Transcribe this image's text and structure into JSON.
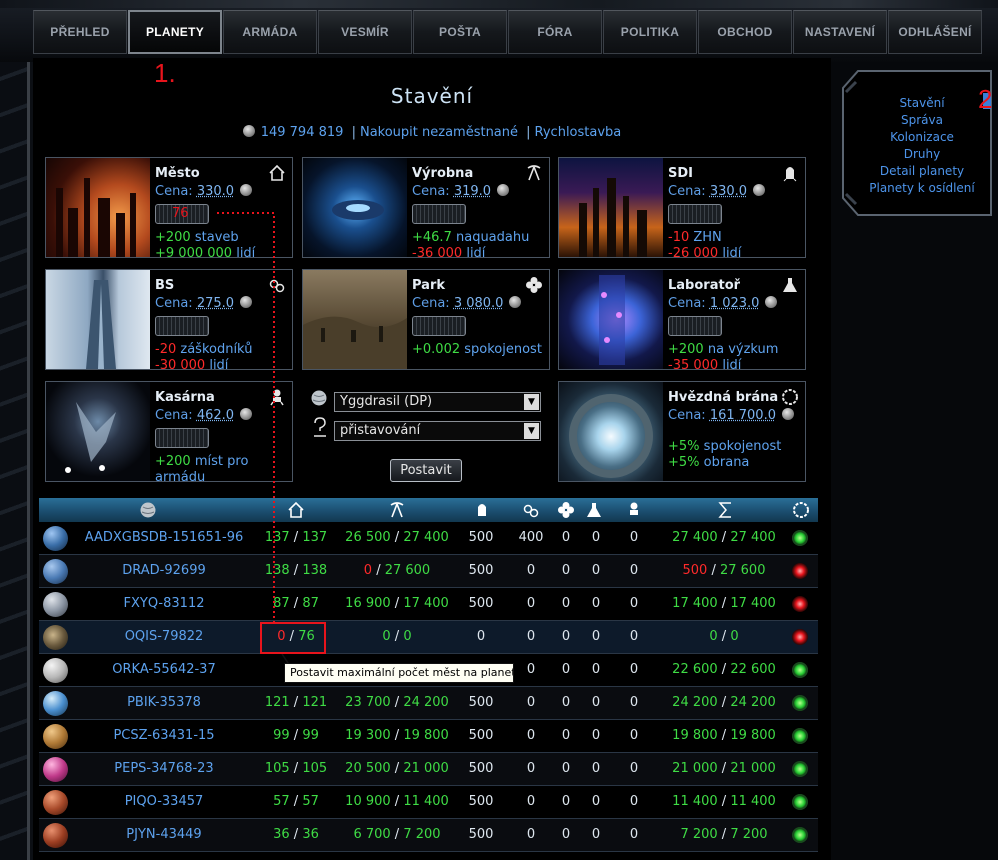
{
  "nav": {
    "items": [
      {
        "label": "PŘEHLED"
      },
      {
        "label": "PLANETY",
        "active": true
      },
      {
        "label": "ARMÁDA"
      },
      {
        "label": "VESMÍR"
      },
      {
        "label": "POŠTA"
      },
      {
        "label": "FÓRA"
      },
      {
        "label": "POLITIKA"
      },
      {
        "label": "OBCHOD"
      },
      {
        "label": "NASTAVENÍ"
      },
      {
        "label": "ODHLÁŠENÍ"
      }
    ]
  },
  "annotations": {
    "one": "1.",
    "two": "2"
  },
  "page_title": "Stavění",
  "info": {
    "money": "149 794 819",
    "buy_unemployed": "Nakoupit nezaměstnané",
    "separator": "|",
    "quick_build": "Rychlostavba"
  },
  "buildings": {
    "mesto": {
      "name": "Město",
      "cost_label": "Cena:",
      "cost": "330.0",
      "qty": "76",
      "eff1_val": "+200",
      "eff1_label": "staveb",
      "eff2_val": "+9 000 000",
      "eff2_label": "lidí"
    },
    "vyrobna": {
      "name": "Výrobna",
      "cost_label": "Cena:",
      "cost": "319.0",
      "qty": "",
      "eff1_val": "+46.7",
      "eff1_label": "naquadahu",
      "eff2_val": "-36 000",
      "eff2_label": "lidí"
    },
    "sdi": {
      "name": "SDI",
      "cost_label": "Cena:",
      "cost": "330.0",
      "qty": "",
      "eff1_val": "-10",
      "eff1_label": "ZHN",
      "eff2_val": "-26 000",
      "eff2_label": "lidí"
    },
    "bs": {
      "name": "BS",
      "cost_label": "Cena:",
      "cost": "275.0",
      "qty": "",
      "eff1_val": "-20",
      "eff1_label": "záškodníků",
      "eff2_val": "-30 000",
      "eff2_label": "lidí"
    },
    "park": {
      "name": "Park",
      "cost_label": "Cena:",
      "cost": "3 080.0",
      "qty": "",
      "eff1_val": "+0.002",
      "eff1_label": "spokojenost",
      "eff2_val": "",
      "eff2_label": ""
    },
    "lab": {
      "name": "Laboratoř",
      "cost_label": "Cena:",
      "cost": "1 023.0",
      "qty": "",
      "eff1_val": "+200",
      "eff1_label": "na výzkum",
      "eff2_val": "-35 000",
      "eff2_label": "lidí"
    },
    "kasarna": {
      "name": "Kasárna",
      "cost_label": "Cena:",
      "cost": "462.0",
      "qty": "",
      "eff1_val": "+200",
      "eff1_label": "míst pro",
      "eff2_val": "",
      "eff2_label": "armádu"
    },
    "brana": {
      "name": "Hvězdná brána",
      "cost_label": "Cena:",
      "cost": "161 700.0",
      "qty": "",
      "eff1_val": "+5%",
      "eff1_label": "spokojenost",
      "eff2_val": "+5%",
      "eff2_label": "obrana"
    }
  },
  "controls": {
    "planet_select": "Yggdrasil (DP)",
    "mode_select": "přistavování",
    "build_button": "Postavit"
  },
  "planets": [
    {
      "name": "AADXGBSDB-151651-96",
      "type": "blue",
      "m_cur": "137",
      "m_max": "137",
      "m_col": "g",
      "v_cur": "26 500",
      "v_max": "27 400",
      "v_col": "g",
      "sdi": "500",
      "bs": "400",
      "park": "0",
      "lab": "0",
      "kas": "0",
      "t_cur": "27 400",
      "t_max": "27 400",
      "t_col": "g",
      "gate": "on"
    },
    {
      "name": "DRAD-92699",
      "type": "blue2",
      "m_cur": "138",
      "m_max": "138",
      "m_col": "g",
      "v_cur": "0",
      "v_max": "27 600",
      "v_col": "r",
      "sdi": "500",
      "bs": "0",
      "park": "0",
      "lab": "0",
      "kas": "0",
      "t_cur": "500",
      "t_max": "27 600",
      "t_col": "r",
      "gate": "off"
    },
    {
      "name": "FXYQ-83112",
      "type": "grey",
      "m_cur": "87",
      "m_max": "87",
      "m_col": "g",
      "v_cur": "16 900",
      "v_max": "17 400",
      "v_col": "g",
      "sdi": "500",
      "bs": "0",
      "park": "0",
      "lab": "0",
      "kas": "0",
      "t_cur": "17 400",
      "t_max": "17 400",
      "t_col": "g",
      "gate": "off"
    },
    {
      "name": "OQIS-79822",
      "type": "rock",
      "m_cur": "0",
      "m_max": "76",
      "m_col": "r",
      "v_cur": "0",
      "v_max": "0",
      "v_col": "g",
      "sdi": "0",
      "bs": "0",
      "park": "0",
      "lab": "0",
      "kas": "0",
      "t_cur": "0",
      "t_max": "0",
      "t_col": "g",
      "gate": "off"
    },
    {
      "name": "ORKA-55642-37",
      "type": "moon",
      "m_cur": "11",
      "m_max": "",
      "m_col": "g",
      "v_cur": "",
      "v_max": "",
      "v_col": "g",
      "sdi": "",
      "bs": "0",
      "park": "0",
      "lab": "0",
      "kas": "0",
      "t_cur": "22 600",
      "t_max": "22 600",
      "t_col": "g",
      "gate": "on"
    },
    {
      "name": "PBIK-35378",
      "type": "earth",
      "m_cur": "121",
      "m_max": "121",
      "m_col": "g",
      "v_cur": "23 700",
      "v_max": "24 200",
      "v_col": "g",
      "sdi": "500",
      "bs": "0",
      "park": "0",
      "lab": "0",
      "kas": "0",
      "t_cur": "24 200",
      "t_max": "24 200",
      "t_col": "g",
      "gate": "on"
    },
    {
      "name": "PCSZ-63431-15",
      "type": "tan",
      "m_cur": "99",
      "m_max": "99",
      "m_col": "g",
      "v_cur": "19 300",
      "v_max": "19 800",
      "v_col": "g",
      "sdi": "500",
      "bs": "0",
      "park": "0",
      "lab": "0",
      "kas": "0",
      "t_cur": "19 800",
      "t_max": "19 800",
      "t_col": "g",
      "gate": "on"
    },
    {
      "name": "PEPS-34768-23",
      "type": "pink",
      "m_cur": "105",
      "m_max": "105",
      "m_col": "g",
      "v_cur": "20 500",
      "v_max": "21 000",
      "v_col": "g",
      "sdi": "500",
      "bs": "0",
      "park": "0",
      "lab": "0",
      "kas": "0",
      "t_cur": "21 000",
      "t_max": "21 000",
      "t_col": "g",
      "gate": "on"
    },
    {
      "name": "PIQO-33457",
      "type": "mars",
      "m_cur": "57",
      "m_max": "57",
      "m_col": "g",
      "v_cur": "10 900",
      "v_max": "11 400",
      "v_col": "g",
      "sdi": "500",
      "bs": "0",
      "park": "0",
      "lab": "0",
      "kas": "0",
      "t_cur": "11 400",
      "t_max": "11 400",
      "t_col": "g",
      "gate": "on"
    },
    {
      "name": "PJYN-43449",
      "type": "mars2",
      "m_cur": "36",
      "m_max": "36",
      "m_col": "g",
      "v_cur": "6 700",
      "v_max": "7 200",
      "v_col": "g",
      "sdi": "500",
      "bs": "0",
      "park": "0",
      "lab": "0",
      "kas": "0",
      "t_cur": "7 200",
      "t_max": "7 200",
      "t_col": "g",
      "gate": "on"
    }
  ],
  "tooltip": "Postavit maximální počet měst na planetě",
  "right_menu": {
    "items": [
      {
        "label": "Stavění"
      },
      {
        "label": "Správa"
      },
      {
        "label": "Kolonizace"
      },
      {
        "label": "Druhy"
      },
      {
        "label": "Detail planety"
      },
      {
        "label": "Planety k osídlení"
      }
    ]
  }
}
